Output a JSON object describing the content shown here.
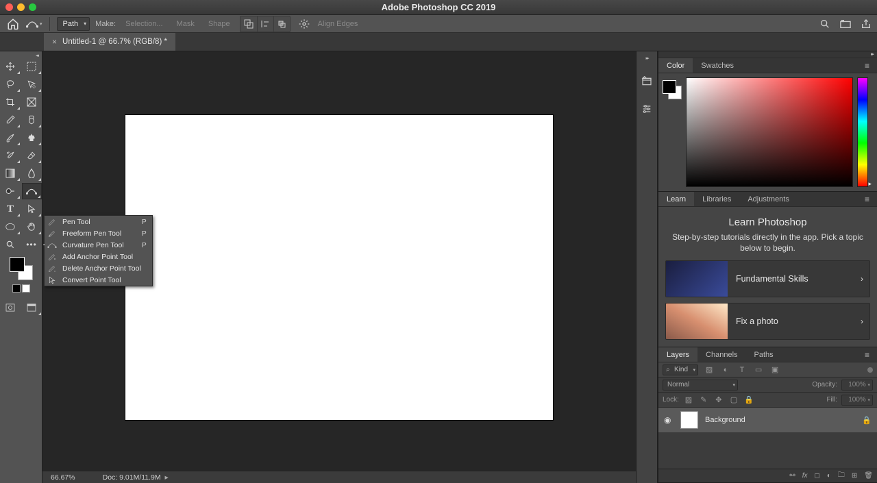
{
  "app": {
    "title": "Adobe Photoshop CC 2019"
  },
  "options": {
    "path_label": "Path",
    "make": "Make:",
    "selection": "Selection...",
    "mask": "Mask",
    "shape": "Shape",
    "align_edges": "Align Edges"
  },
  "document": {
    "tab_title": "Untitled-1 @ 66.7% (RGB/8) *"
  },
  "flyout": {
    "items": [
      {
        "label": "Pen Tool",
        "shortcut": "P",
        "selected": false
      },
      {
        "label": "Freeform Pen Tool",
        "shortcut": "P",
        "selected": false
      },
      {
        "label": "Curvature Pen Tool",
        "shortcut": "P",
        "selected": true
      },
      {
        "label": "Add Anchor Point Tool",
        "shortcut": "",
        "selected": false
      },
      {
        "label": "Delete Anchor Point Tool",
        "shortcut": "",
        "selected": false
      },
      {
        "label": "Convert Point Tool",
        "shortcut": "",
        "selected": false
      }
    ]
  },
  "status": {
    "zoom": "66.67%",
    "doc": "Doc: 9.01M/11.9M"
  },
  "color_panel": {
    "tabs": [
      "Color",
      "Swatches"
    ],
    "active": "Color"
  },
  "learn_panel": {
    "tabs": [
      "Learn",
      "Libraries",
      "Adjustments"
    ],
    "active": "Learn",
    "heading": "Learn Photoshop",
    "sub": "Step-by-step tutorials directly in the app. Pick a topic below to begin.",
    "tiles": [
      {
        "name": "Fundamental Skills"
      },
      {
        "name": "Fix a photo"
      }
    ]
  },
  "layers_panel": {
    "tabs": [
      "Layers",
      "Channels",
      "Paths"
    ],
    "active": "Layers",
    "kind": "Kind",
    "blend": "Normal",
    "opacity_label": "Opacity:",
    "opacity_value": "100%",
    "lock_label": "Lock:",
    "fill_label": "Fill:",
    "fill_value": "100%",
    "layer_name": "Background"
  }
}
